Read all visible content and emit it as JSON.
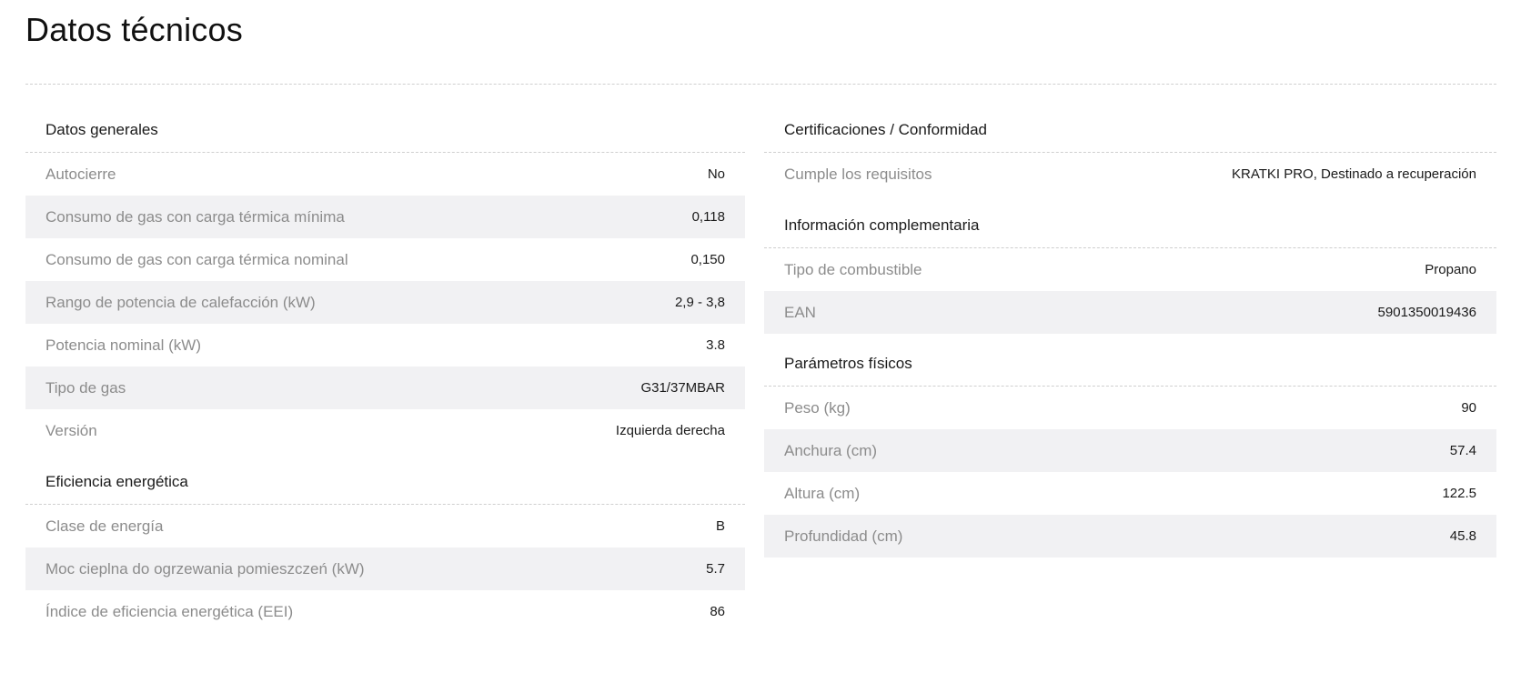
{
  "page": {
    "title": "Datos técnicos"
  },
  "left": {
    "general": {
      "heading": "Datos generales",
      "rows": [
        {
          "label": "Autocierre",
          "value": "No"
        },
        {
          "label": "Consumo de gas con carga térmica mínima",
          "value": "0,118"
        },
        {
          "label": "Consumo de gas con carga térmica nominal",
          "value": "0,150"
        },
        {
          "label": "Rango de potencia de calefacción (kW)",
          "value": "2,9 - 3,8"
        },
        {
          "label": "Potencia nominal (kW)",
          "value": "3.8"
        },
        {
          "label": "Tipo de gas",
          "value": "G31/37MBAR"
        },
        {
          "label": "Versión",
          "value": "Izquierda derecha"
        }
      ]
    },
    "energy": {
      "heading": "Eficiencia energética",
      "rows": [
        {
          "label": "Clase de energía",
          "value": "B"
        },
        {
          "label": "Moc cieplna do ogrzewania pomieszczeń (kW)",
          "value": "5.7"
        },
        {
          "label": "Índice de eficiencia energética (EEI)",
          "value": "86"
        }
      ]
    }
  },
  "right": {
    "certs": {
      "heading": "Certificaciones / Conformidad",
      "rows": [
        {
          "label": "Cumple los requisitos",
          "value": "KRATKI PRO, Destinado a recuperación"
        }
      ]
    },
    "extra": {
      "heading": "Información complementaria",
      "rows": [
        {
          "label": "Tipo de combustible",
          "value": "Propano"
        },
        {
          "label": "EAN",
          "value": "5901350019436"
        }
      ]
    },
    "physical": {
      "heading": "Parámetros físicos",
      "rows": [
        {
          "label": "Peso (kg)",
          "value": "90"
        },
        {
          "label": "Anchura (cm)",
          "value": "57.4"
        },
        {
          "label": "Altura (cm)",
          "value": "122.5"
        },
        {
          "label": "Profundidad (cm)",
          "value": "45.8"
        }
      ]
    }
  },
  "colors": {
    "row_shade": "#f1f1f3",
    "label": "#8c8c8c",
    "value": "#1a1a1a",
    "divider": "#cfcfcf"
  }
}
